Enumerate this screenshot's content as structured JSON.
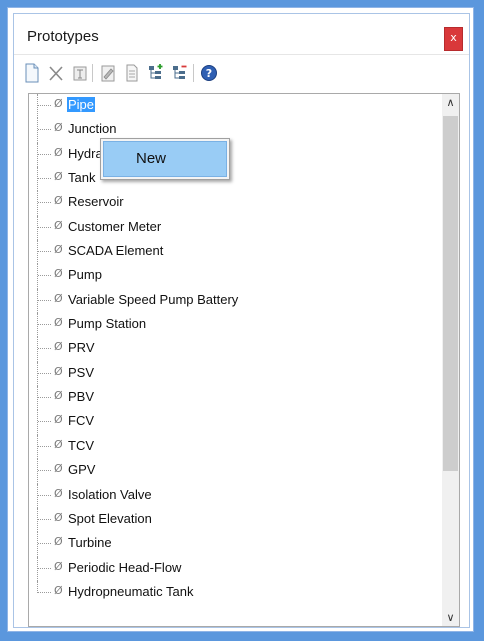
{
  "window": {
    "title": "Prototypes",
    "close_label": "x"
  },
  "toolbar": {
    "buttons": [
      "new-icon",
      "delete-icon",
      "rename-icon",
      "edit-icon",
      "report-icon",
      "expand-all-icon",
      "collapse-all-icon",
      "help-icon"
    ]
  },
  "tree": {
    "items": [
      "Pipe",
      "Junction",
      "Hydrant",
      "Tank",
      "Reservoir",
      "Customer Meter",
      "SCADA Element",
      "Pump",
      "Variable Speed Pump Battery",
      "Pump Station",
      "PRV",
      "PSV",
      "PBV",
      "FCV",
      "TCV",
      "GPV",
      "Isolation Valve",
      "Spot Elevation",
      "Turbine",
      "Periodic Head-Flow",
      "Hydropneumatic Tank"
    ],
    "selected_index": 0,
    "node_symbol": "Ø"
  },
  "context_menu": {
    "items": [
      "New"
    ]
  },
  "colors": {
    "accent": "#3399ff",
    "frame": "#5b97dd",
    "close": "#d9383a",
    "menu_highlight": "#99ccf5"
  }
}
